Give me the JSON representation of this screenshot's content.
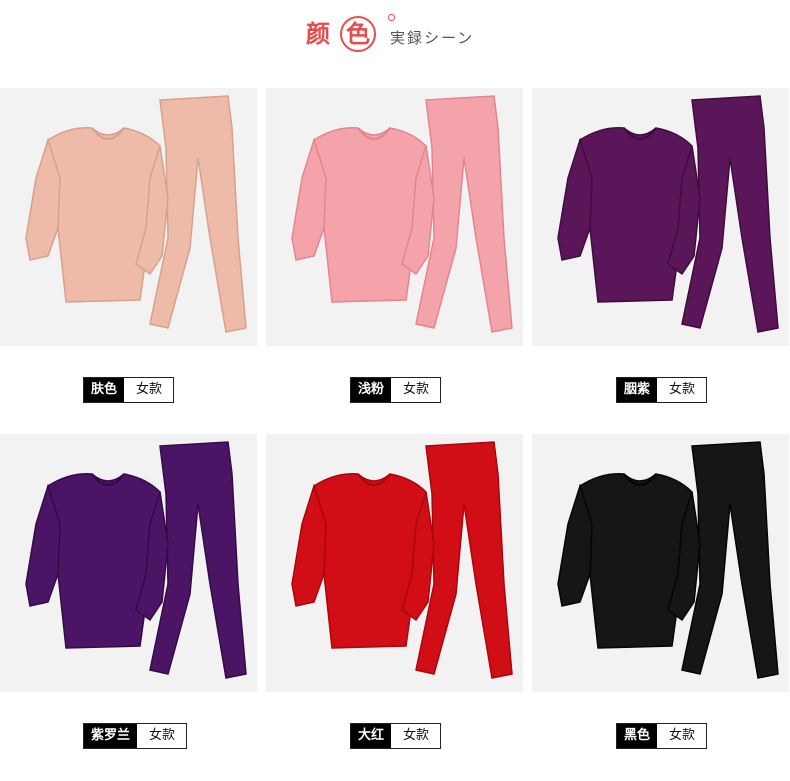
{
  "header": {
    "char1": "颜",
    "char2": "色",
    "subtitle": "実録シーン"
  },
  "items": [
    {
      "color_name": "肤色",
      "style": "女款",
      "swatch": "#eebba8",
      "shade": "#d9a08d"
    },
    {
      "color_name": "浅粉",
      "style": "女款",
      "swatch": "#f4a3ab",
      "shade": "#e38590"
    },
    {
      "color_name": "胭紫",
      "style": "女款",
      "swatch": "#5b1659",
      "shade": "#3e0c3d"
    },
    {
      "color_name": "紫罗兰",
      "style": "女款",
      "swatch": "#4c1465",
      "shade": "#340a47"
    },
    {
      "color_name": "大红",
      "style": "女款",
      "swatch": "#d10e16",
      "shade": "#a9060d"
    },
    {
      "color_name": "黑色",
      "style": "女款",
      "swatch": "#161616",
      "shade": "#050505"
    }
  ]
}
